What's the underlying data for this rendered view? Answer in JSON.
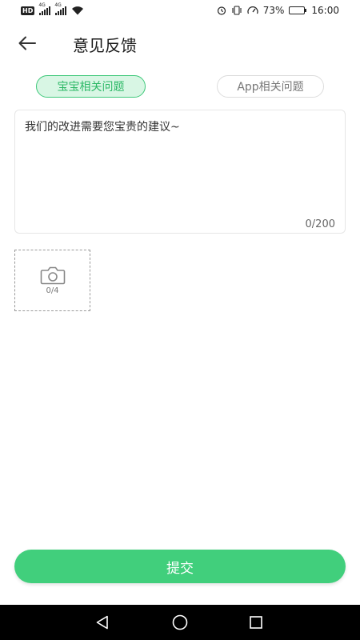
{
  "status_bar": {
    "hd_label": "HD",
    "network_1": "4G",
    "network_2": "4G",
    "battery_text": "73%",
    "battery_level": 0.73,
    "time": "16:00"
  },
  "header": {
    "title": "意见反馈"
  },
  "tabs": [
    {
      "label": "宝宝相关问题",
      "selected": true
    },
    {
      "label": "App相关问题",
      "selected": false
    }
  ],
  "feedback": {
    "value": "",
    "placeholder": "我们的改进需要您宝贵的建议~",
    "char_count": "0/200"
  },
  "photo": {
    "count": "0/4"
  },
  "submit": {
    "label": "提交"
  },
  "colors": {
    "accent": "#41cf7c",
    "tab_selected_bg": "#d8f6e4",
    "tab_selected_text": "#2cb866",
    "nav_bar": "#000000"
  },
  "icons": {
    "back": "arrow-left-icon",
    "camera": "camera-icon",
    "nav_back": "triangle-back-icon",
    "nav_home": "circle-home-icon",
    "nav_recent": "square-recent-icon"
  }
}
